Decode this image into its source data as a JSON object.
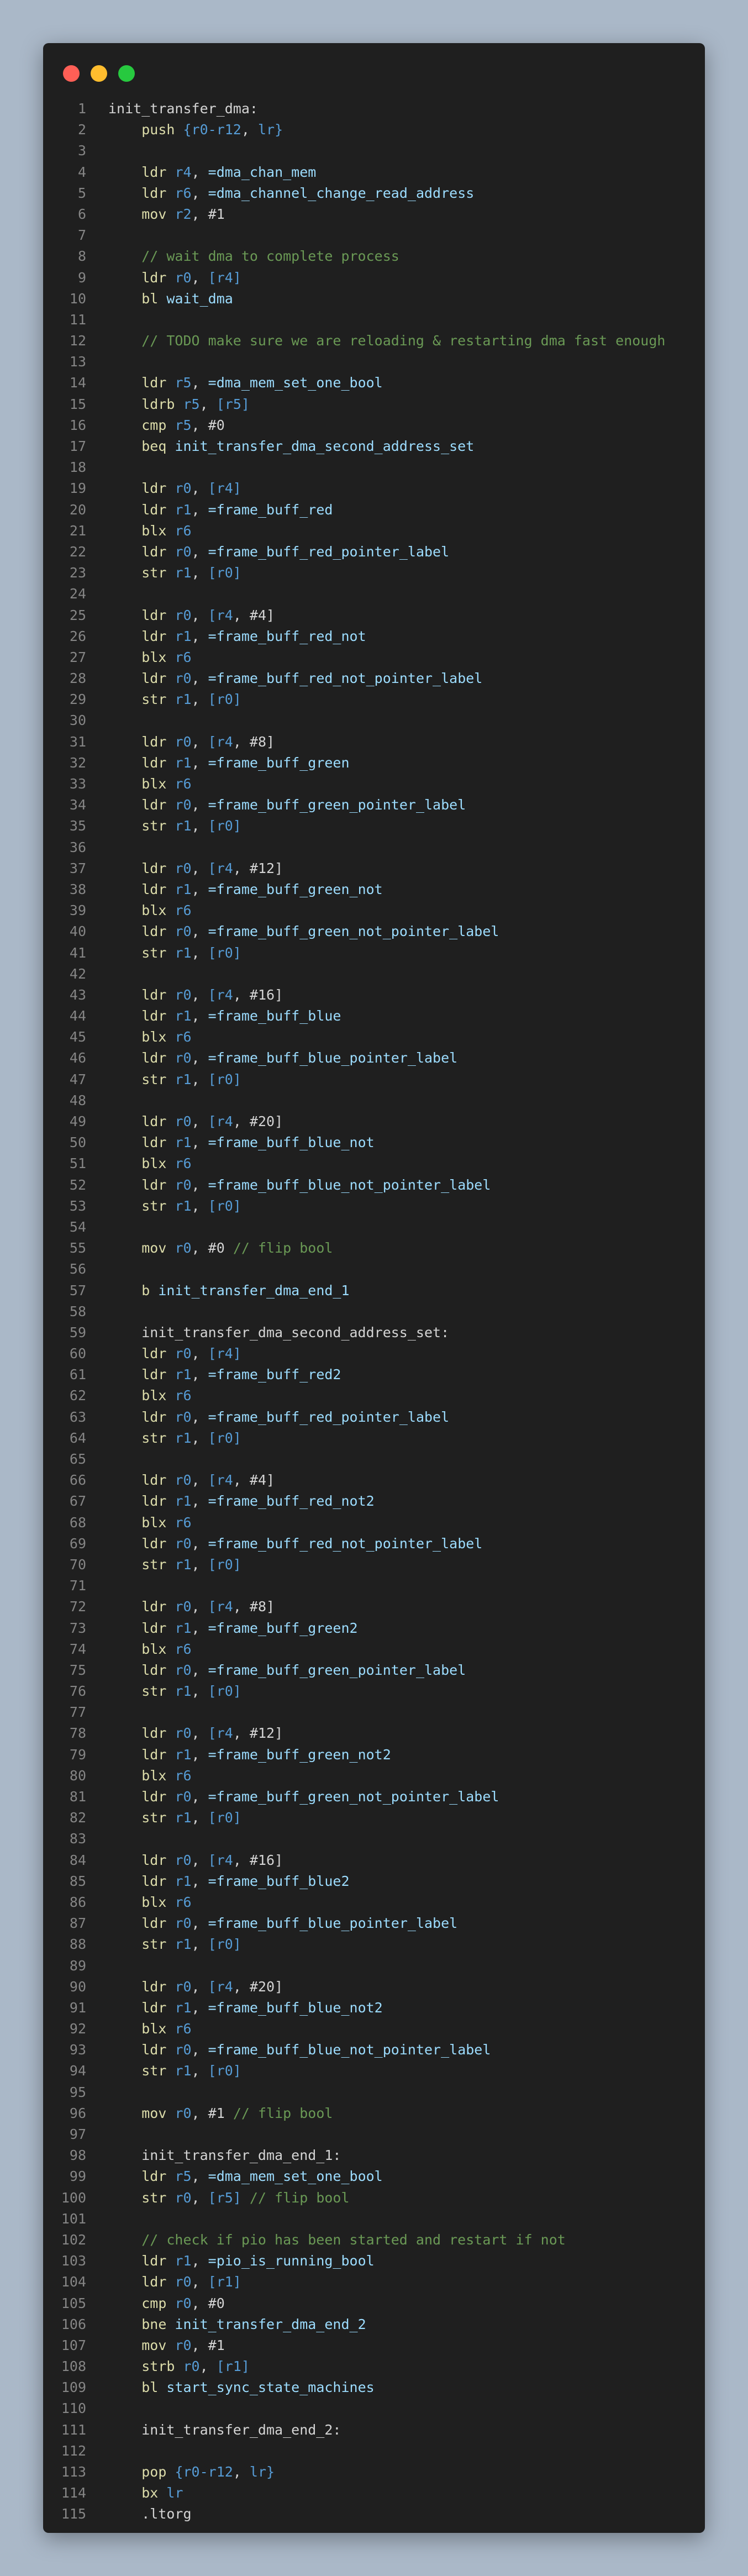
{
  "window": {
    "controls": [
      "close",
      "minimize",
      "maximize"
    ],
    "colors": {
      "close": "#ff5f56",
      "minimize": "#ffbd2e",
      "maximize": "#27c93f",
      "background": "#1f1f1f"
    }
  },
  "code_lines": [
    "init_transfer_dma:",
    "    push {r0-r12, lr}",
    "",
    "    ldr r4, =dma_chan_mem",
    "    ldr r6, =dma_channel_change_read_address",
    "    mov r2, #1",
    "",
    "    // wait dma to complete process",
    "    ldr r0, [r4]",
    "    bl wait_dma",
    "",
    "    // TODO make sure we are reloading & restarting dma fast enough",
    "",
    "    ldr r5, =dma_mem_set_one_bool",
    "    ldrb r5, [r5]",
    "    cmp r5, #0",
    "    beq init_transfer_dma_second_address_set",
    "",
    "    ldr r0, [r4]",
    "    ldr r1, =frame_buff_red",
    "    blx r6",
    "    ldr r0, =frame_buff_red_pointer_label",
    "    str r1, [r0]",
    "",
    "    ldr r0, [r4, #4]",
    "    ldr r1, =frame_buff_red_not",
    "    blx r6",
    "    ldr r0, =frame_buff_red_not_pointer_label",
    "    str r1, [r0]",
    "",
    "    ldr r0, [r4, #8]",
    "    ldr r1, =frame_buff_green",
    "    blx r6",
    "    ldr r0, =frame_buff_green_pointer_label",
    "    str r1, [r0]",
    "",
    "    ldr r0, [r4, #12]",
    "    ldr r1, =frame_buff_green_not",
    "    blx r6",
    "    ldr r0, =frame_buff_green_not_pointer_label",
    "    str r1, [r0]",
    "",
    "    ldr r0, [r4, #16]",
    "    ldr r1, =frame_buff_blue",
    "    blx r6",
    "    ldr r0, =frame_buff_blue_pointer_label",
    "    str r1, [r0]",
    "",
    "    ldr r0, [r4, #20]",
    "    ldr r1, =frame_buff_blue_not",
    "    blx r6",
    "    ldr r0, =frame_buff_blue_not_pointer_label",
    "    str r1, [r0]",
    "",
    "    mov r0, #0 // flip bool",
    "",
    "    b init_transfer_dma_end_1",
    "",
    "    init_transfer_dma_second_address_set:",
    "    ldr r0, [r4]",
    "    ldr r1, =frame_buff_red2",
    "    blx r6",
    "    ldr r0, =frame_buff_red_pointer_label",
    "    str r1, [r0]",
    "",
    "    ldr r0, [r4, #4]",
    "    ldr r1, =frame_buff_red_not2",
    "    blx r6",
    "    ldr r0, =frame_buff_red_not_pointer_label",
    "    str r1, [r0]",
    "",
    "    ldr r0, [r4, #8]",
    "    ldr r1, =frame_buff_green2",
    "    blx r6",
    "    ldr r0, =frame_buff_green_pointer_label",
    "    str r1, [r0]",
    "",
    "    ldr r0, [r4, #12]",
    "    ldr r1, =frame_buff_green_not2",
    "    blx r6",
    "    ldr r0, =frame_buff_green_not_pointer_label",
    "    str r1, [r0]",
    "",
    "    ldr r0, [r4, #16]",
    "    ldr r1, =frame_buff_blue2",
    "    blx r6",
    "    ldr r0, =frame_buff_blue_pointer_label",
    "    str r1, [r0]",
    "",
    "    ldr r0, [r4, #20]",
    "    ldr r1, =frame_buff_blue_not2",
    "    blx r6",
    "    ldr r0, =frame_buff_blue_not_pointer_label",
    "    str r1, [r0]",
    "",
    "    mov r0, #1 // flip bool",
    "",
    "    init_transfer_dma_end_1:",
    "    ldr r5, =dma_mem_set_one_bool",
    "    str r0, [r5] // flip bool",
    "",
    "    // check if pio has been started and restart if not",
    "    ldr r1, =pio_is_running_bool",
    "    ldr r0, [r1]",
    "    cmp r0, #0",
    "    bne init_transfer_dma_end_2",
    "    mov r0, #1",
    "    strb r0, [r1]",
    "    bl start_sync_state_machines",
    "",
    "    init_transfer_dma_end_2:",
    "",
    "    pop {r0-r12, lr}",
    "    bx lr",
    "    .ltorg"
  ]
}
